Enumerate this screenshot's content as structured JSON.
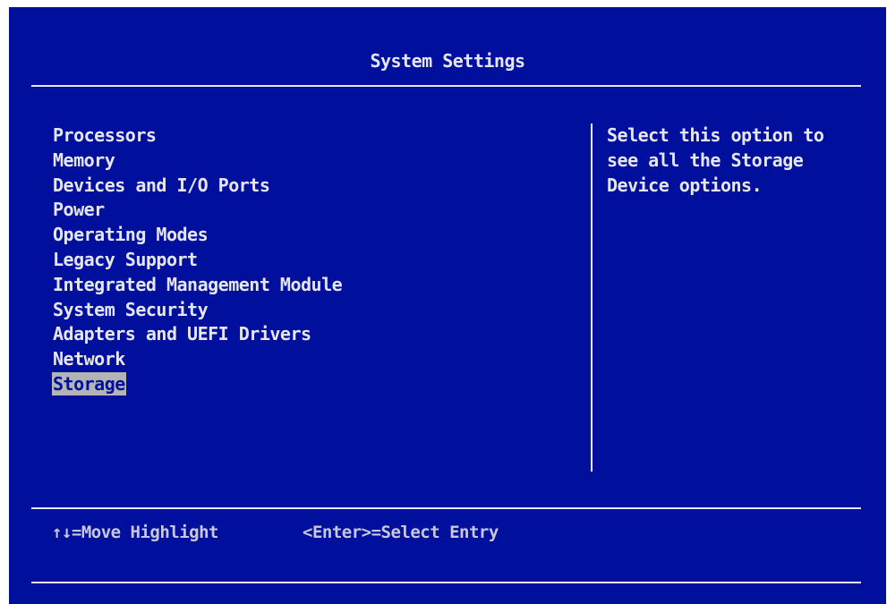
{
  "header": {
    "title": "System Settings"
  },
  "menu": {
    "items": [
      {
        "label": "Processors",
        "selected": false
      },
      {
        "label": "Memory",
        "selected": false
      },
      {
        "label": "Devices and I/O Ports",
        "selected": false
      },
      {
        "label": "Power",
        "selected": false
      },
      {
        "label": "Operating Modes",
        "selected": false
      },
      {
        "label": "Legacy Support",
        "selected": false
      },
      {
        "label": "Integrated Management Module",
        "selected": false
      },
      {
        "label": "System Security",
        "selected": false
      },
      {
        "label": "Adapters and UEFI Drivers",
        "selected": false
      },
      {
        "label": "Network",
        "selected": false
      },
      {
        "label": "Storage",
        "selected": true
      }
    ]
  },
  "help": {
    "text": "Select this option to\nsee all the Storage\nDevice options."
  },
  "footer": {
    "move_hint": "↑↓=Move Highlight",
    "enter_hint": "<Enter>=Select Entry"
  },
  "colors": {
    "background": "#000f9c",
    "text": "#e6e6f2",
    "highlight": "#b4b4b4"
  }
}
